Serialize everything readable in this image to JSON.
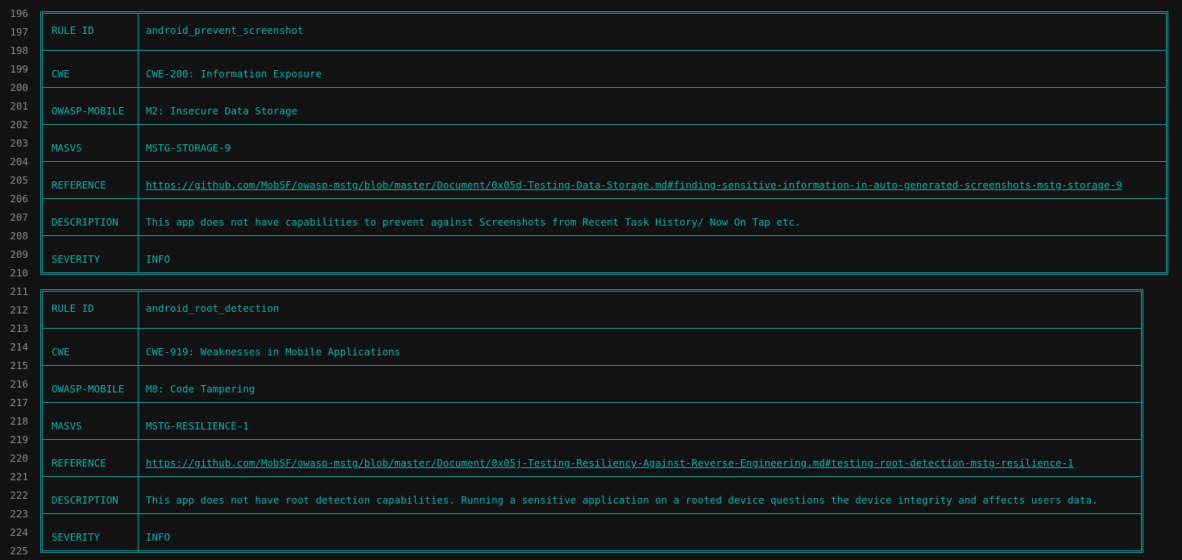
{
  "line_numbers": [
    "196",
    "197",
    "198",
    "199",
    "200",
    "201",
    "202",
    "203",
    "204",
    "205",
    "206",
    "207",
    "208",
    "209",
    "210",
    "211",
    "212",
    "213",
    "214",
    "215",
    "216",
    "217",
    "218",
    "219",
    "220",
    "221",
    "222",
    "223",
    "224",
    "225"
  ],
  "colors": {
    "background": "#121212",
    "border": "#1aa5a5",
    "text": "#1ab0b0",
    "line_number": "#8b8b8b"
  },
  "tables": [
    {
      "rows": [
        {
          "key": "RULE ID",
          "value": "android_prevent_screenshot"
        },
        {
          "key": "CWE",
          "value": "CWE-200: Information Exposure"
        },
        {
          "key": "OWASP-MOBILE",
          "value": "M2: Insecure Data Storage"
        },
        {
          "key": "MASVS",
          "value": "MSTG-STORAGE-9"
        },
        {
          "key": "REFERENCE",
          "value": "https://github.com/MobSF/owasp-mstg/blob/master/Document/0x05d-Testing-Data-Storage.md#finding-sensitive-information-in-auto-generated-screenshots-mstg-storage-9"
        },
        {
          "key": "DESCRIPTION",
          "value": "This app does not have capabilities to prevent against Screenshots from Recent Task History/ Now On Tap etc."
        },
        {
          "key": "SEVERITY",
          "value": "INFO"
        }
      ]
    },
    {
      "rows": [
        {
          "key": "RULE ID",
          "value": "android_root_detection"
        },
        {
          "key": "CWE",
          "value": "CWE-919: Weaknesses in Mobile Applications"
        },
        {
          "key": "OWASP-MOBILE",
          "value": "M8: Code Tampering"
        },
        {
          "key": "MASVS",
          "value": "MSTG-RESILIENCE-1"
        },
        {
          "key": "REFERENCE",
          "value": "https://github.com/MobSF/owasp-mstg/blob/master/Document/0x05j-Testing-Resiliency-Against-Reverse-Engineering.md#testing-root-detection-mstg-resilience-1"
        },
        {
          "key": "DESCRIPTION",
          "value": "This app does not have root detection capabilities. Running a sensitive application on a rooted device questions the device integrity and affects users data."
        },
        {
          "key": "SEVERITY",
          "value": "INFO"
        }
      ]
    }
  ]
}
